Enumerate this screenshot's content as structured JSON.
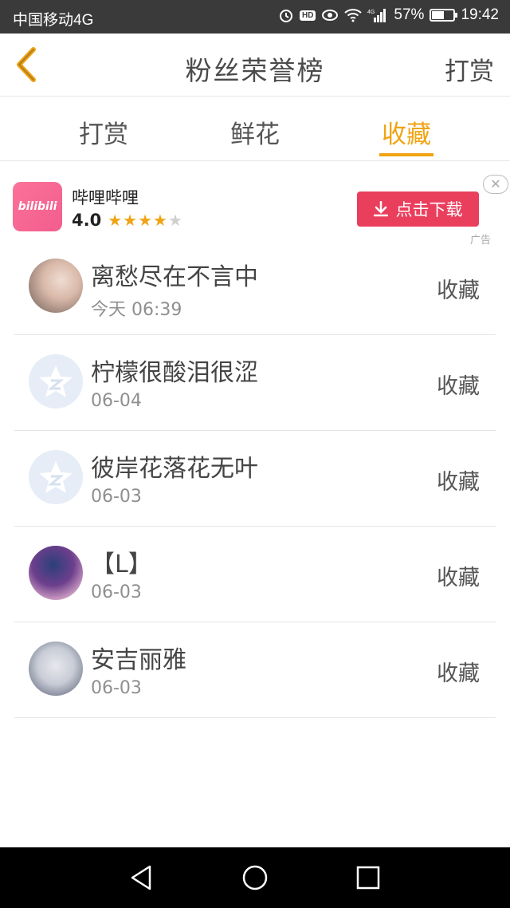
{
  "status_bar": {
    "carrier": "中国移动4G",
    "hd": "HD",
    "network": "4G",
    "battery": "57%",
    "battery_level": 0.57,
    "time": "19:42"
  },
  "header": {
    "title": "粉丝荣誉榜",
    "right_action": "打赏"
  },
  "tabs": [
    {
      "label": "打赏",
      "active": false
    },
    {
      "label": "鲜花",
      "active": false
    },
    {
      "label": "收藏",
      "active": true
    }
  ],
  "accent_color": "#f0a413",
  "ad": {
    "logo_text": "bilibili",
    "app_name": "哔哩哔哩",
    "rating": "4.0",
    "stars": 4,
    "stars_max": 5,
    "download_label": "点击下载",
    "close_label": "✕",
    "ad_label": "广告",
    "download_color": "#ea3e5d"
  },
  "list": [
    {
      "name": "离愁尽在不言中",
      "date": "今天 06:39",
      "action": "收藏",
      "avatar": "photo"
    },
    {
      "name": "柠檬很酸泪很涩",
      "date": "06-04",
      "action": "收藏",
      "avatar": "default"
    },
    {
      "name": "彼岸花落花无叶",
      "date": "06-03",
      "action": "收藏",
      "avatar": "default"
    },
    {
      "name": "【L】",
      "date": "06-03",
      "action": "收藏",
      "avatar": "anime"
    },
    {
      "name": "安吉丽雅",
      "date": "06-03",
      "action": "收藏",
      "avatar": "anime"
    }
  ]
}
